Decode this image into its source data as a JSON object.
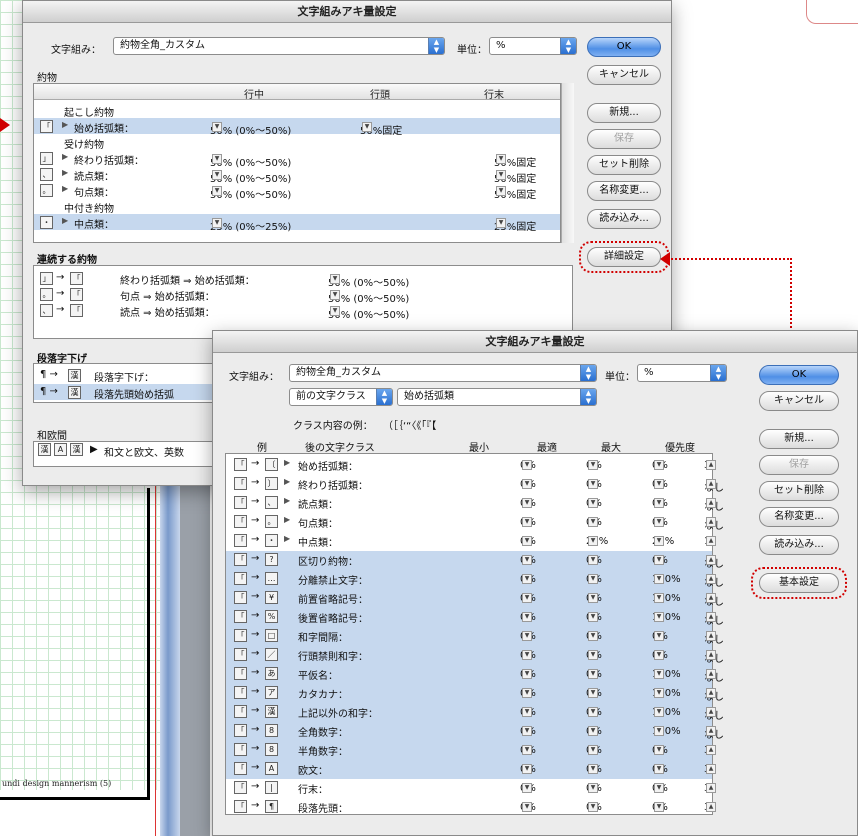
{
  "background": {
    "footer_text": "undi  design mannerism (5)"
  },
  "dialog1": {
    "title": "文字組みアキ量設定",
    "mojikumi_label": "文字組み：",
    "mojikumi_value": "約物全角_カスタム",
    "unit_label": "単位：",
    "unit_value": "%",
    "section_yakumono": "約物",
    "columns": [
      "行中",
      "行頭",
      "行末"
    ],
    "groups": [
      {
        "name": "起こし約物",
        "rows": [
          {
            "label": "始め括弧類：",
            "mid": "50% (0%〜50%)",
            "head": "50%固定",
            "tail": "",
            "selected": true
          }
        ]
      },
      {
        "name": "受け約物",
        "rows": [
          {
            "label": "終わり括弧類：",
            "mid": "50% (0%〜50%)",
            "head": "",
            "tail": "50%固定",
            "selected": false
          },
          {
            "label": "読点類：",
            "mid": "50% (0%〜50%)",
            "head": "",
            "tail": "50%固定",
            "selected": false
          },
          {
            "label": "句点類：",
            "mid": "50% (0%〜50%)",
            "head": "",
            "tail": "50%固定",
            "selected": false
          }
        ]
      },
      {
        "name": "中付き約物",
        "rows": [
          {
            "label": "中点類：",
            "mid": "25% (0%〜25%)",
            "head": "",
            "tail": "25%固定",
            "selected": true
          }
        ]
      }
    ],
    "section_renzoku": "連続する約物",
    "renzoku_rows": [
      {
        "label": "終わり括弧類 ⇒ 始め括弧類：",
        "value": "50% (0%〜50%)"
      },
      {
        "label": "句点 ⇒ 始め括弧類：",
        "value": "50% (0%〜50%)"
      },
      {
        "label": "読点 ⇒ 始め括弧類：",
        "value": "50% (0%〜50%)"
      }
    ],
    "section_danraku": "段落字下げ",
    "danraku_rows": [
      {
        "label": "段落字下げ：",
        "selected": false
      },
      {
        "label": "段落先頭始め括弧",
        "selected": true
      }
    ],
    "section_waobun": "和欧間",
    "waobun_label": "和文と欧文、英数",
    "buttons": {
      "ok": "OK",
      "cancel": "キャンセル",
      "new": "新規...",
      "save": "保存",
      "delete": "セット削除",
      "rename": "名称変更...",
      "load": "読み込み...",
      "detail": "詳細設定"
    }
  },
  "dialog2": {
    "title": "文字組みアキ量設定",
    "mojikumi_label": "文字組み：",
    "mojikumi_value": "約物全角_カスタム",
    "unit_label": "単位：",
    "unit_value": "%",
    "class_before": "前の文字クラス",
    "class_after": "始め括弧類",
    "example_label": "クラス内容の例：",
    "example_chars": "（［｛‘“〈《「『【",
    "columns": {
      "example": "例",
      "after_class": "後の文字クラス",
      "min": "最小",
      "opt": "最適",
      "max": "最大",
      "priority": "優先度"
    },
    "rows": [
      {
        "icon": "〔",
        "label": "始め括弧類：",
        "min": "0%",
        "opt": "0%",
        "max": "0%",
        "pri": "3",
        "selected": false,
        "expand": true
      },
      {
        "icon": "〕",
        "label": "終わり括弧類：",
        "min": "0%",
        "opt": "0%",
        "max": "0%",
        "pri": "なし",
        "selected": false,
        "expand": true
      },
      {
        "icon": "、",
        "label": "読点類：",
        "min": "0%",
        "opt": "0%",
        "max": "0%",
        "pri": "なし",
        "selected": false,
        "expand": true
      },
      {
        "icon": "。",
        "label": "句点類：",
        "min": "0%",
        "opt": "0%",
        "max": "0%",
        "pri": "なし",
        "selected": false,
        "expand": true
      },
      {
        "icon": "・",
        "label": "中点類：",
        "min": "0%",
        "opt": "25%",
        "max": "25%",
        "pri": "1",
        "selected": false,
        "expand": true
      },
      {
        "icon": "?",
        "label": "区切り約物：",
        "min": "0%",
        "opt": "0%",
        "max": "0%",
        "pri": "なし",
        "selected": true,
        "expand": false
      },
      {
        "icon": "…",
        "label": "分離禁止文字：",
        "min": "0%",
        "opt": "0%",
        "max": "100%",
        "pri": "なし",
        "selected": true,
        "expand": false
      },
      {
        "icon": "¥",
        "label": "前置省略記号：",
        "min": "0%",
        "opt": "0%",
        "max": "100%",
        "pri": "なし",
        "selected": true,
        "expand": false
      },
      {
        "icon": "%",
        "label": "後置省略記号：",
        "min": "0%",
        "opt": "0%",
        "max": "100%",
        "pri": "なし",
        "selected": true,
        "expand": false
      },
      {
        "icon": "□",
        "label": "和字間隔：",
        "min": "0%",
        "opt": "0%",
        "max": "0%",
        "pri": "なし",
        "selected": true,
        "expand": false
      },
      {
        "icon": "／",
        "label": "行頭禁則和字：",
        "min": "0%",
        "opt": "0%",
        "max": "0%",
        "pri": "なし",
        "selected": true,
        "expand": false
      },
      {
        "icon": "あ",
        "label": "平仮名：",
        "min": "0%",
        "opt": "0%",
        "max": "100%",
        "pri": "なし",
        "selected": true,
        "expand": false
      },
      {
        "icon": "ア",
        "label": "カタカナ：",
        "min": "0%",
        "opt": "0%",
        "max": "100%",
        "pri": "なし",
        "selected": true,
        "expand": false
      },
      {
        "icon": "漢",
        "label": "上記以外の和字：",
        "min": "0%",
        "opt": "0%",
        "max": "100%",
        "pri": "なし",
        "selected": true,
        "expand": false
      },
      {
        "icon": "8",
        "label": "全角数字：",
        "min": "0%",
        "opt": "0%",
        "max": "100%",
        "pri": "なし",
        "selected": true,
        "expand": false
      },
      {
        "icon": "8",
        "label": "半角数字：",
        "min": "0%",
        "opt": "0%",
        "max": "0%",
        "pri": "3",
        "selected": true,
        "expand": false
      },
      {
        "icon": "A",
        "label": "欧文：",
        "min": "0%",
        "opt": "0%",
        "max": "0%",
        "pri": "3",
        "selected": true,
        "expand": false
      },
      {
        "icon": "|",
        "label": "行末：",
        "min": "0%",
        "opt": "0%",
        "max": "0%",
        "pri": "3",
        "selected": false,
        "expand": false
      },
      {
        "icon": "¶",
        "label": "段落先頭：",
        "min": "0%",
        "opt": "0%",
        "max": "0%",
        "pri": "3",
        "selected": false,
        "expand": false
      }
    ],
    "buttons": {
      "ok": "OK",
      "cancel": "キャンセル",
      "new": "新規...",
      "save": "保存",
      "delete": "セット削除",
      "rename": "名称変更...",
      "load": "読み込み...",
      "basic": "基本設定"
    }
  },
  "colors": {
    "callout": "#d10000",
    "selection": "#c6d8ee",
    "default_button": "#4f8fe6"
  }
}
